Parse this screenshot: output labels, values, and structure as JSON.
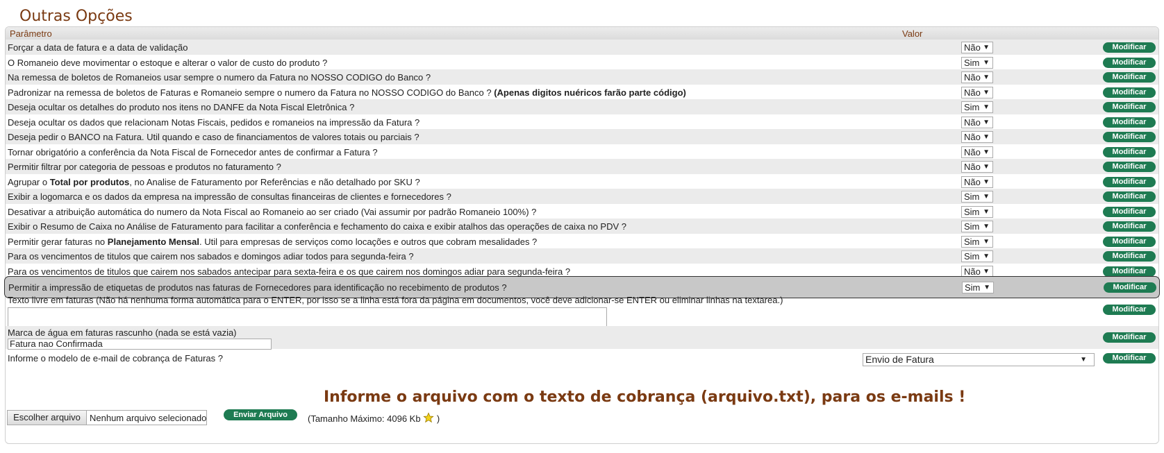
{
  "page_title": "Outras Opções",
  "header": {
    "param": "Parâmetro",
    "value": "Valor"
  },
  "modify_label": "Modificar",
  "rows": [
    {
      "q": [
        "Forçar a data de fatura e a data de validação"
      ],
      "v": "Não"
    },
    {
      "q": [
        "O Romaneio deve movimentar o estoque e alterar o valor de custo do produto ?"
      ],
      "v": "Sim"
    },
    {
      "q": [
        "Na remessa de boletos de Romaneios usar sempre o numero da Fatura no NOSSO CODIGO do Banco ?"
      ],
      "v": "Não"
    },
    {
      "q": [
        "Padronizar na remessa de boletos de Faturas e Romaneio sempre o numero da Fatura no NOSSO CODIGO do Banco ? ",
        "(Apenas digitos nuéricos farão parte código)"
      ],
      "v": "Não"
    },
    {
      "q": [
        "Deseja ocultar os detalhes do produto nos itens no DANFE da Nota Fiscal Eletrônica ?"
      ],
      "v": "Sim"
    },
    {
      "q": [
        "Deseja ocultar os dados que relacionam Notas Fiscais, pedidos e romaneios na impressão da Fatura ?"
      ],
      "v": "Não"
    },
    {
      "q": [
        "Deseja pedir o BANCO na Fatura. Util quando e caso de financiamentos de valores totais ou parciais ?"
      ],
      "v": "Não"
    },
    {
      "q": [
        "Tornar obrigatório a conferência da Nota Fiscal de Fornecedor antes de confirmar a Fatura ?"
      ],
      "v": "Não"
    },
    {
      "q": [
        "Permitir filtrar por categoria de pessoas e produtos no faturamento ?"
      ],
      "v": "Não"
    },
    {
      "q": [
        "Agrupar o ",
        "Total por produtos",
        ", no Analise de Faturamento por Referências e não detalhado por SKU ?"
      ],
      "v": "Não"
    },
    {
      "q": [
        "Exibir a logomarca e os dados da empresa na impressão de consultas financeiras de clientes e fornecedores ?"
      ],
      "v": "Sim"
    },
    {
      "q": [
        "Desativar a atribuição automática do numero da Nota Fiscal ao Romaneio ao ser criado (Vai assumir por padrão Romaneio 100%) ?"
      ],
      "v": "Sim"
    },
    {
      "q": [
        "Exibir o Resumo de Caixa no Análise de Faturamento para facilitar a conferência e fechamento do caixa e exibir atalhos das operações de caixa no PDV ?"
      ],
      "v": "Sim"
    },
    {
      "q": [
        "Permitir gerar faturas no ",
        "Planejamento Mensal",
        ". Util para empresas de serviços como locações e outros que cobram mesalidades ?"
      ],
      "v": "Sim"
    },
    {
      "q": [
        "Para os vencimentos de titulos que cairem nos sabados e domingos adiar todos para segunda-feira ?"
      ],
      "v": "Sim"
    },
    {
      "q": [
        "Para os vencimentos de titulos que cairem nos sabados antecipar para sexta-feira e os que cairem nos domingos adiar para segunda-feira ?"
      ],
      "v": "Não"
    },
    {
      "q": [
        "Permitir a impressão de etiquetas de produtos nas faturas de Fornecedores para identificação no recebimento de produtos ?"
      ],
      "v": "Sim"
    }
  ],
  "free_text": {
    "label": "Texto livre em faturas (Não há nenhuma forma automática para o ENTER, por isso se a linha está fora da página em documentos, você deve adicionar-se ENTER ou eliminar linhas na textarea.)",
    "value": ""
  },
  "watermark": {
    "label": "Marca de água em faturas rascunho (nada se está vazia)",
    "value": "Fatura nao Confirmada"
  },
  "email_model": {
    "label": "Informe o modelo de e-mail de cobrança de Faturas ?",
    "selected": "Envio de Fatura"
  },
  "upload": {
    "heading": "Informe o arquivo com o texto de cobrança (arquivo.txt), para os e-mails !",
    "choose_label": "Escolher arquivo",
    "no_file": "Nenhum arquivo selecionado",
    "send_label": "Enviar Arquivo",
    "max_size": "(Tamanho Máximo: 4096 Kb",
    "max_size_close": ")"
  },
  "colors": {
    "accent": "#7a3a12",
    "button": "#1e7b52",
    "row_alt": "#ebebeb"
  }
}
